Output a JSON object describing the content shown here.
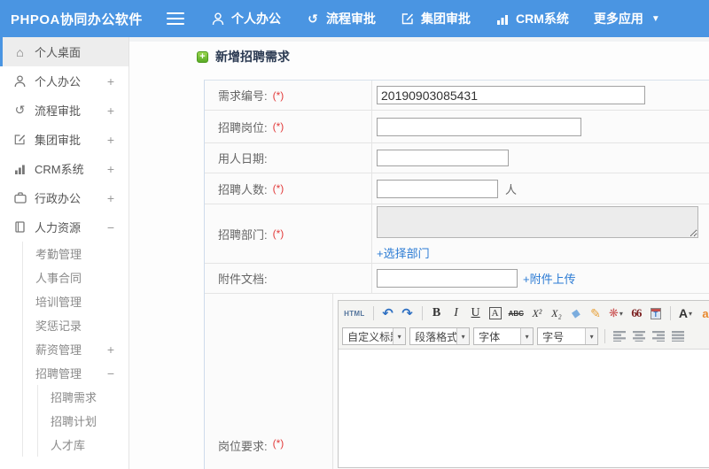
{
  "colors": {
    "topbar": "#4a95e2",
    "link": "#2b7bd4",
    "required": "#e23b3b",
    "title_plus": "#5aab26"
  },
  "topbar": {
    "brand": "PHPOA协同办公软件",
    "nav": [
      {
        "label": "个人办公",
        "icon": "person-icon"
      },
      {
        "label": "流程审批",
        "icon": "history-icon"
      },
      {
        "label": "集团审批",
        "icon": "edit-square-icon"
      },
      {
        "label": "CRM系统",
        "icon": "bar-chart-icon"
      },
      {
        "label": "更多应用",
        "icon": "caret-down-icon"
      }
    ],
    "glyphs": {
      "history": "↺",
      "caret": "▼"
    }
  },
  "sidebar": {
    "items": [
      {
        "label": "个人桌面",
        "icon": "home-icon",
        "expand": "",
        "active": true
      },
      {
        "label": "个人办公",
        "icon": "person-icon",
        "expand": "+"
      },
      {
        "label": "流程审批",
        "icon": "history-icon",
        "expand": "+"
      },
      {
        "label": "集团审批",
        "icon": "edit-square-icon",
        "expand": "+"
      },
      {
        "label": "CRM系统",
        "icon": "bar-chart-icon",
        "expand": "+"
      },
      {
        "label": "行政办公",
        "icon": "briefcase-icon",
        "expand": "+"
      },
      {
        "label": "人力资源",
        "icon": "book-icon",
        "expand": "−"
      }
    ],
    "hr_children": [
      {
        "label": "考勤管理",
        "expand": ""
      },
      {
        "label": "人事合同",
        "expand": ""
      },
      {
        "label": "培训管理",
        "expand": ""
      },
      {
        "label": "奖惩记录",
        "expand": ""
      },
      {
        "label": "薪资管理",
        "expand": "+"
      },
      {
        "label": "招聘管理",
        "expand": "−"
      }
    ],
    "recruit_children": [
      {
        "label": "招聘需求"
      },
      {
        "label": "招聘计划"
      },
      {
        "label": "人才库"
      }
    ],
    "glyphs": {
      "home": "⌂",
      "history": "↺"
    }
  },
  "main": {
    "title": "新增招聘需求",
    "form": {
      "required_mark": "(*)",
      "rows": [
        {
          "label": "需求编号:",
          "value": "20190903085431"
        },
        {
          "label": "招聘岗位:",
          "value": ""
        },
        {
          "label": "用人日期:",
          "value": ""
        },
        {
          "label": "招聘人数:",
          "value": "",
          "suffix": "人"
        },
        {
          "label": "招聘部门:",
          "link": "+选择部门"
        },
        {
          "label": "附件文档:",
          "value": "",
          "link": "+附件上传"
        },
        {
          "label": "岗位要求:"
        }
      ]
    }
  },
  "editor": {
    "toolbar": {
      "html_label": "HTML",
      "undo_glyph": "↶",
      "redo_glyph": "↷",
      "bold": "B",
      "italic": "I",
      "underline": "U",
      "char_border": "A",
      "strike": "ABC",
      "superscript": "X²",
      "subscript": "X₂",
      "eraser_glyph": "◆",
      "brush_glyph": "✎",
      "palette_glyph": "❋",
      "quote": "66",
      "clipboard_letter": "T",
      "font_color": "A",
      "highlight": "a",
      "mini_caret": "▾"
    },
    "selects": [
      {
        "label": "自定义标题"
      },
      {
        "label": "段落格式"
      },
      {
        "label": "字体"
      },
      {
        "label": "字号"
      }
    ]
  }
}
